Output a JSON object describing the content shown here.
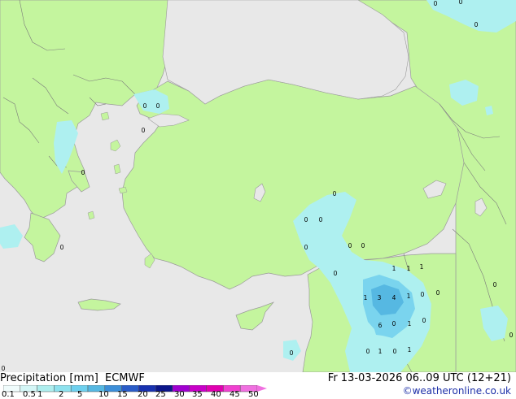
{
  "map": {
    "colors": {
      "sea": "#e8e8e8",
      "land": "#c4f59e",
      "coast": "#9a9a9a",
      "border": "#7a7a7a",
      "precip_light": "#aef0f0",
      "precip_mid": "#7ad4ee",
      "precip_heavy": "#56b8e2"
    },
    "amount_labels": [
      {
        "text": "0",
        "gx": 535,
        "gy": 4
      },
      {
        "text": "0",
        "gx": 566,
        "gy": 2
      },
      {
        "text": "0",
        "gx": 585,
        "gy": 30
      },
      {
        "text": "0",
        "gx": 178,
        "gy": 130
      },
      {
        "text": "0",
        "gx": 194,
        "gy": 130
      },
      {
        "text": "0",
        "gx": 176,
        "gy": 160
      },
      {
        "text": "0",
        "gx": 102,
        "gy": 212
      },
      {
        "text": "0",
        "gx": 411,
        "gy": 238
      },
      {
        "text": "0",
        "gx": 376,
        "gy": 270
      },
      {
        "text": "0",
        "gx": 394,
        "gy": 270
      },
      {
        "text": "0",
        "gx": 76,
        "gy": 304
      },
      {
        "text": "0",
        "gx": 376,
        "gy": 304
      },
      {
        "text": "0",
        "gx": 430,
        "gy": 302
      },
      {
        "text": "0",
        "gx": 446,
        "gy": 302
      },
      {
        "text": "0",
        "gx": 412,
        "gy": 336
      },
      {
        "text": "1",
        "gx": 484,
        "gy": 330
      },
      {
        "text": "1",
        "gx": 502,
        "gy": 330
      },
      {
        "text": "1",
        "gx": 518,
        "gy": 328
      },
      {
        "text": "0",
        "gx": 608,
        "gy": 350
      },
      {
        "text": "1",
        "gx": 449,
        "gy": 366
      },
      {
        "text": "3",
        "gx": 466,
        "gy": 366
      },
      {
        "text": "4",
        "gx": 484,
        "gy": 366
      },
      {
        "text": "1",
        "gx": 502,
        "gy": 364
      },
      {
        "text": "0",
        "gx": 519,
        "gy": 362
      },
      {
        "text": "0",
        "gx": 538,
        "gy": 360
      },
      {
        "text": "6",
        "gx": 467,
        "gy": 400
      },
      {
        "text": "0",
        "gx": 484,
        "gy": 398
      },
      {
        "text": "1",
        "gx": 503,
        "gy": 398
      },
      {
        "text": "0",
        "gx": 521,
        "gy": 394
      },
      {
        "text": "0",
        "gx": 628,
        "gy": 412
      },
      {
        "text": "0",
        "gx": 358,
        "gy": 434
      },
      {
        "text": "0",
        "gx": 452,
        "gy": 432
      },
      {
        "text": "1",
        "gx": 467,
        "gy": 432
      },
      {
        "text": "0",
        "gx": 485,
        "gy": 432
      },
      {
        "text": "1",
        "gx": 503,
        "gy": 430
      },
      {
        "text": "0",
        "gx": 4,
        "gy": 453
      }
    ]
  },
  "footer": {
    "title": "Precipitation [mm]",
    "model": "ECMWF",
    "valid_time": "Fr 13-03-2026 06..09 UTC (12+21)",
    "copyright": "©weatheronline.co.uk",
    "legend": {
      "ticks": [
        "0.1",
        "0.5",
        "1",
        "2",
        "5",
        "10",
        "15",
        "20",
        "25",
        "30",
        "35",
        "40",
        "45",
        "50"
      ],
      "colors": [
        "#f0fcfc",
        "#d4f6f6",
        "#aeeeee",
        "#8ee2ee",
        "#6ed0ee",
        "#56b8e2",
        "#3c8ed8",
        "#2a5cc8",
        "#1832b0",
        "#0c168a",
        "#a000d0",
        "#c800c8",
        "#e000b0",
        "#f040d0",
        "#f070e0"
      ]
    }
  }
}
